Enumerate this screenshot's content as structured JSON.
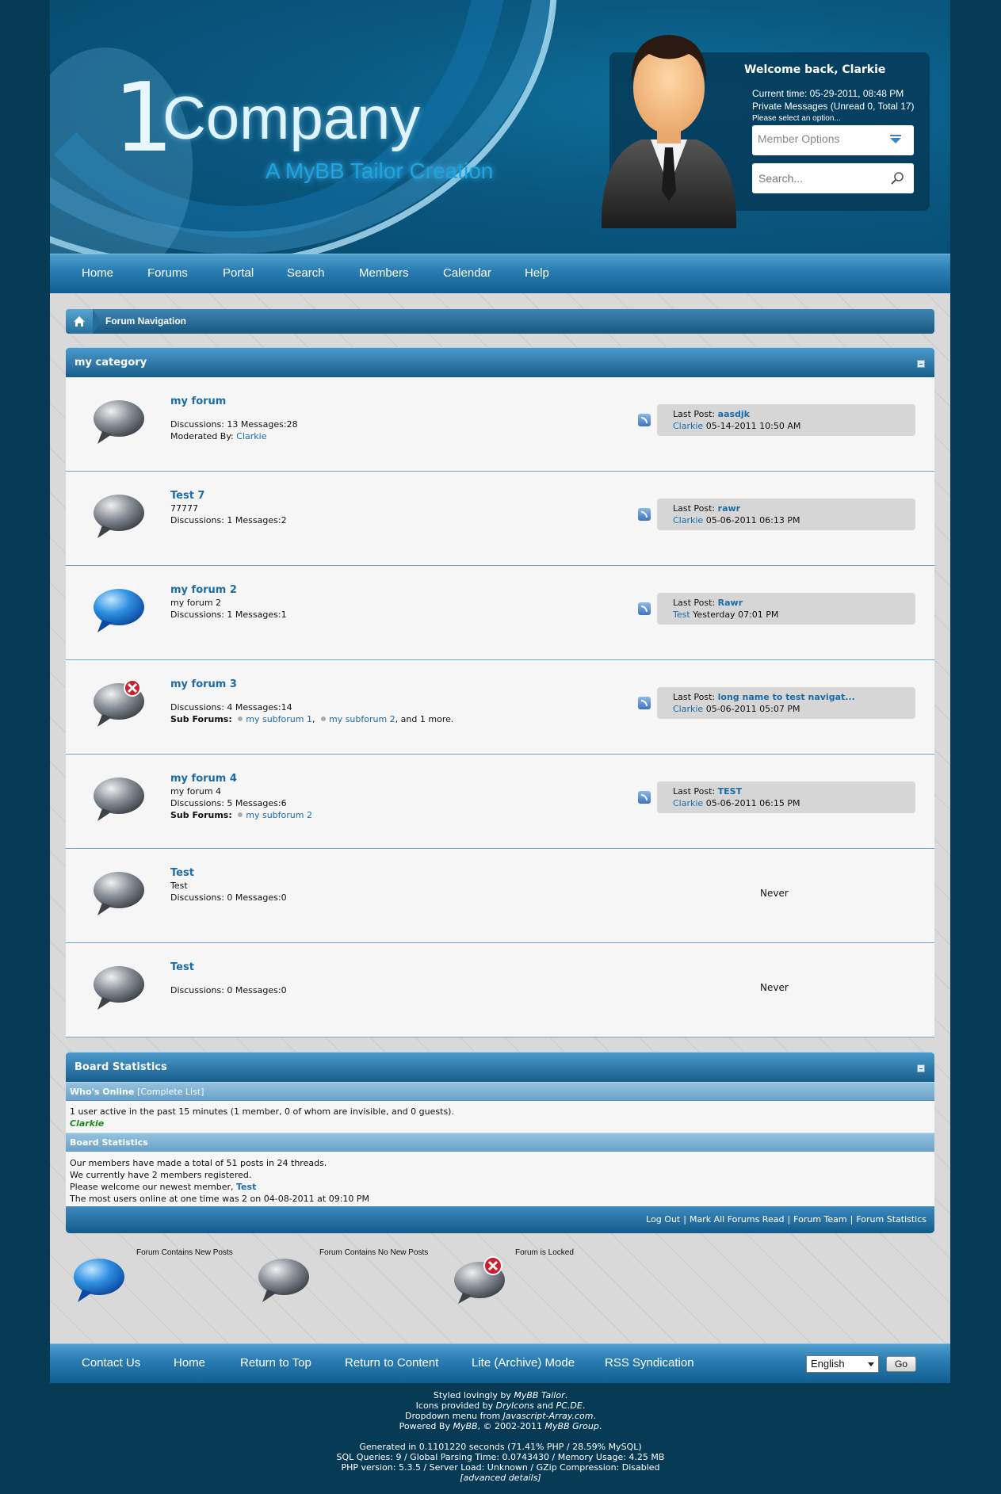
{
  "header": {
    "logo_number": "1",
    "logo_name": "Company",
    "logo_tagline": "A MyBB Tailor Creation",
    "welcome": "Welcome back, Clarkie",
    "current_time": "Current time: 05-29-2011, 08:48 PM",
    "private_messages": "Private Messages (Unread 0, Total 17)",
    "option_hint": "Please select an option...",
    "member_options": "Member Options",
    "search_placeholder": "Search..."
  },
  "topnav": [
    "Home",
    "Forums",
    "Portal",
    "Search",
    "Members",
    "Calendar",
    "Help"
  ],
  "breadcrumb": "Forum Navigation",
  "category": {
    "title": "my category",
    "forums": [
      {
        "name": "my forum",
        "description": "",
        "stats": "Discussions: 13 Messages:28",
        "moderated_label": "Moderated By:",
        "moderator": "Clarkie",
        "subforums_label": "",
        "subforums": [],
        "more": "",
        "last_post_label": "Last Post:",
        "last_post_title": "aasdjk",
        "last_post_user": "Clarkie",
        "last_post_date": "05-14-2011 10:50 AM",
        "status": "old",
        "never": ""
      },
      {
        "name": "Test 7",
        "description": "77777",
        "stats": "Discussions: 1 Messages:2",
        "moderated_label": "",
        "moderator": "",
        "subforums_label": "",
        "subforums": [],
        "more": "",
        "last_post_label": "Last Post:",
        "last_post_title": "rawr",
        "last_post_user": "Clarkie",
        "last_post_date": "05-06-2011 06:13 PM",
        "status": "old",
        "never": ""
      },
      {
        "name": "my forum 2",
        "description": "my forum 2",
        "stats": "Discussions: 1 Messages:1",
        "moderated_label": "",
        "moderator": "",
        "subforums_label": "",
        "subforums": [],
        "more": "",
        "last_post_label": "Last Post:",
        "last_post_title": "Rawr",
        "last_post_user": "Test",
        "last_post_date": "Yesterday 07:01 PM",
        "status": "new",
        "never": ""
      },
      {
        "name": "my forum 3",
        "description": "",
        "stats": "Discussions: 4 Messages:14",
        "moderated_label": "",
        "moderator": "",
        "subforums_label": "Sub Forums:",
        "subforums": [
          "my subforum 1",
          "my subforum 2"
        ],
        "more": ", and 1 more.",
        "last_post_label": "Last Post:",
        "last_post_title": "long name to test navigat...",
        "last_post_user": "Clarkie",
        "last_post_date": "05-06-2011 05:07 PM",
        "status": "locked",
        "never": ""
      },
      {
        "name": "my forum 4",
        "description": "my forum 4",
        "stats": "Discussions: 5 Messages:6",
        "moderated_label": "",
        "moderator": "",
        "subforums_label": "Sub Forums:",
        "subforums": [
          "my subforum 2"
        ],
        "more": "",
        "last_post_label": "Last Post:",
        "last_post_title": "TEST",
        "last_post_user": "Clarkie",
        "last_post_date": "05-06-2011 06:15 PM",
        "status": "old",
        "never": ""
      },
      {
        "name": "Test",
        "description": "Test",
        "stats": "Discussions: 0 Messages:0",
        "moderated_label": "",
        "moderator": "",
        "subforums_label": "",
        "subforums": [],
        "more": "",
        "last_post_label": "",
        "last_post_title": "",
        "last_post_user": "",
        "last_post_date": "",
        "status": "old",
        "never": "Never"
      },
      {
        "name": "Test",
        "description": "",
        "stats": "Discussions: 0 Messages:0",
        "moderated_label": "",
        "moderator": "",
        "subforums_label": "",
        "subforums": [],
        "more": "",
        "last_post_label": "",
        "last_post_title": "",
        "last_post_user": "",
        "last_post_date": "",
        "status": "old",
        "never": "Never"
      }
    ]
  },
  "stats": {
    "title": "Board Statistics",
    "whos_online": "Who's Online",
    "complete_list": "[Complete List]",
    "active_line": "1 user active in the past 15 minutes (1 member, 0 of whom are invisible, and 0 guests).",
    "online_user": "Clarkie",
    "board_stats": "Board Statistics",
    "line1": "Our members have made a total of 51 posts in 24 threads.",
    "line2": "We currently have 2 members registered.",
    "line3": "Please welcome our newest member,",
    "newest_member": "Test",
    "line4": "The most users online at one time was 2 on 04-08-2011 at 09:10 PM",
    "footer_links": [
      "Log Out",
      "Mark All Forums Read",
      "Forum Team",
      "Forum Statistics"
    ]
  },
  "legend": [
    "Forum Contains New Posts",
    "Forum Contains No New Posts",
    "Forum is Locked"
  ],
  "footnav": [
    "Contact Us",
    "Home",
    "Return to Top",
    "Return to Content",
    "Lite (Archive) Mode",
    "RSS Syndication"
  ],
  "language": {
    "selected": "English",
    "go": "Go"
  },
  "credits": {
    "styled_prefix": "Styled lovingly by ",
    "styled_by": "MyBB Tailor",
    "styled_suffix": ".",
    "icons_prefix": "Icons provided by ",
    "icons_a": "DryIcons",
    "icons_and": " and ",
    "icons_b": "PC.DE",
    "icons_suffix": ".",
    "dropdown_prefix": "Dropdown menu from ",
    "dropdown_by": "Javascript-Array.com",
    "dropdown_suffix": ".",
    "powered_prefix": "Powered By ",
    "powered_by": "MyBB",
    "powered_mid": ", © 2002-2011 ",
    "powered_group": "MyBB Group",
    "powered_suffix": ".",
    "generated": "Generated in 0.1101220 seconds (71.41% PHP / 28.59% MySQL)",
    "queries": "SQL Queries: 9 / Global Parsing Time: 0.0743430 / Memory Usage: 4.25 MB",
    "php": "PHP version: 5.3.5 / Server Load: Unknown / GZip Compression: Disabled",
    "advanced": "[advanced details]"
  },
  "colors": {
    "link": "#1b6ca8",
    "nav": "#2b7eb3",
    "page_bg": "#063a55"
  }
}
